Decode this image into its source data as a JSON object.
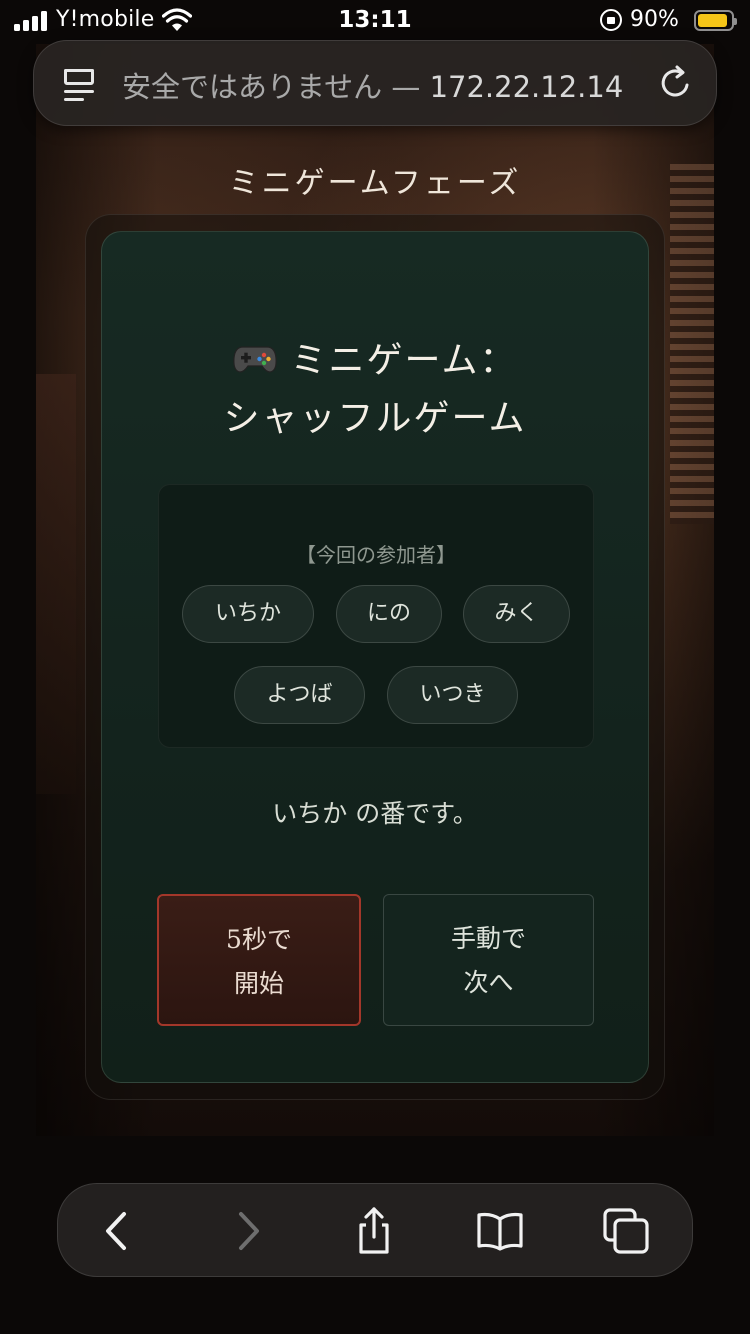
{
  "status_bar": {
    "carrier": "Y!mobile",
    "time": "13:11",
    "battery_percent": "90%",
    "battery_level": 0.9,
    "battery_color": "#f5c518"
  },
  "address_bar": {
    "security_label": "安全ではありません",
    "separator": " — ",
    "host": "172.22.12.14",
    "menu_icon": "page-menu-icon",
    "reload_icon": "reload-icon"
  },
  "page": {
    "phase_title": "ミニゲームフェーズ",
    "minigame": {
      "icon": "gamepad-icon",
      "title_line1": "ミニゲーム：",
      "title_line2": "シャッフルゲーム"
    },
    "participants_label": "【今回の参加者】",
    "participants": [
      "いちか",
      "にの",
      "みく",
      "よつば",
      "いつき"
    ],
    "turn_text": "いちか の番です。",
    "buttons": {
      "auto_line1": "5秒で",
      "auto_line2": "開始",
      "manual_line1": "手動で",
      "manual_line2": "次へ"
    },
    "colors": {
      "panel": "#172a23",
      "accent_border": "#a3372a"
    }
  },
  "toolbar": {
    "back_icon": "back-icon",
    "forward_icon": "forward-icon",
    "share_icon": "share-icon",
    "bookmarks_icon": "bookmarks-icon",
    "tabs_icon": "tabs-icon"
  }
}
